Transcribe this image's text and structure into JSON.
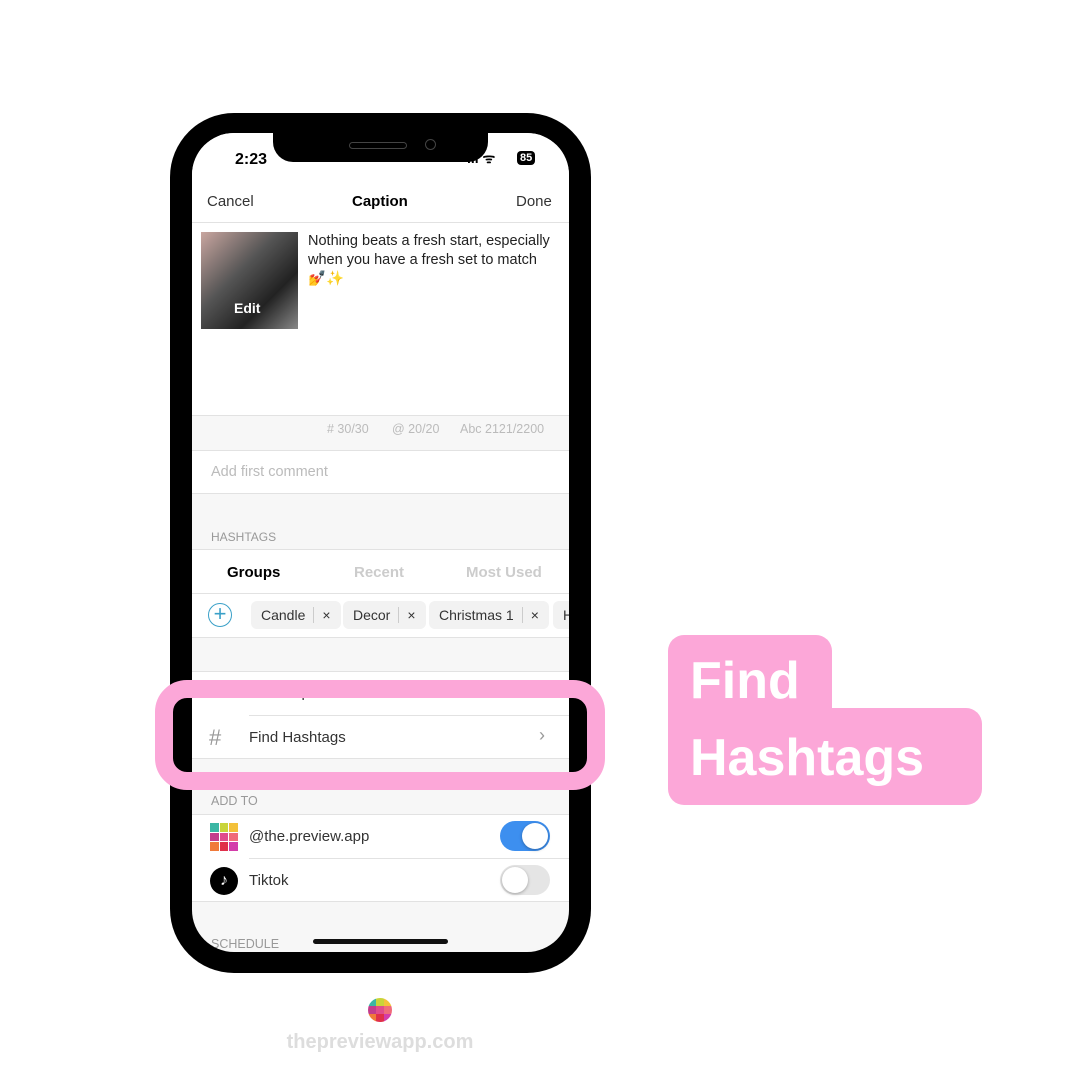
{
  "status": {
    "time": "2:23",
    "battery": "85"
  },
  "nav": {
    "cancel": "Cancel",
    "title": "Caption",
    "done": "Done"
  },
  "post": {
    "thumb_label": "Edit",
    "caption": "Nothing beats a fresh start, especially when you have a fresh set to match 💅✨"
  },
  "counters": {
    "hashtags": "# 30/30",
    "mentions": "@ 20/20",
    "chars": "Abc 2121/2200"
  },
  "comment": {
    "placeholder": "Add first comment"
  },
  "hashtags": {
    "section": "HASHTAGS",
    "tabs": [
      "Groups",
      "Recent",
      "Most Used"
    ],
    "active_tab": "Groups",
    "chips": [
      "Candle",
      "Decor",
      "Christmas 1",
      "H"
    ]
  },
  "tools": {
    "find_captions": "Find Captions",
    "find_hashtags": "Find Hashtags"
  },
  "add_to": {
    "section": "ADD TO",
    "accounts": [
      {
        "name": "@the.preview.app",
        "enabled": true
      },
      {
        "name": "Tiktok",
        "enabled": false
      }
    ]
  },
  "schedule": {
    "section": "SCHEDULE"
  },
  "callout": {
    "line1": "Find",
    "line2": "Hashtags"
  },
  "footer": {
    "site": "thepreviewapp.com"
  },
  "colors": {
    "accent_pink": "#fca7d8",
    "toggle_on": "#3d8fef"
  }
}
